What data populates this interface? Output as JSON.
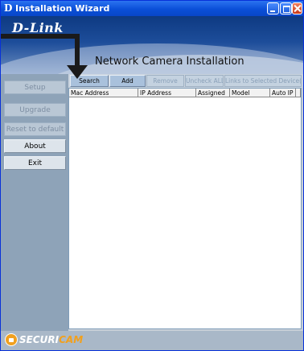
{
  "window": {
    "title": "Installation Wizard",
    "app_icon": "D"
  },
  "banner": {
    "logo": "D-Link",
    "title": "Network Camera Installation"
  },
  "sidebar": {
    "items": [
      {
        "label": "Setup",
        "enabled": false
      },
      {
        "label": "Upgrade",
        "enabled": false
      },
      {
        "label": "Reset to default",
        "enabled": false
      },
      {
        "label": "About",
        "enabled": true
      },
      {
        "label": "Exit",
        "enabled": true
      }
    ]
  },
  "toolbar": {
    "buttons": [
      {
        "label": "Search",
        "enabled": true
      },
      {
        "label": "Add",
        "enabled": true
      },
      {
        "label": "Remove",
        "enabled": false
      },
      {
        "label": "Uncheck ALL",
        "enabled": false
      },
      {
        "label": "Links to Selected Device(s)",
        "enabled": false
      }
    ]
  },
  "list": {
    "columns": [
      "Mac Address",
      "IP Address",
      "Assigned",
      "Model",
      "Auto IP"
    ],
    "rows": []
  },
  "footer": {
    "brand_part1": "SECURI",
    "brand_part2": "CAM"
  },
  "colors": {
    "accent": "#f2a01c",
    "titlebar": "#0a4fd8",
    "sidebar": "#8ea3b8"
  }
}
